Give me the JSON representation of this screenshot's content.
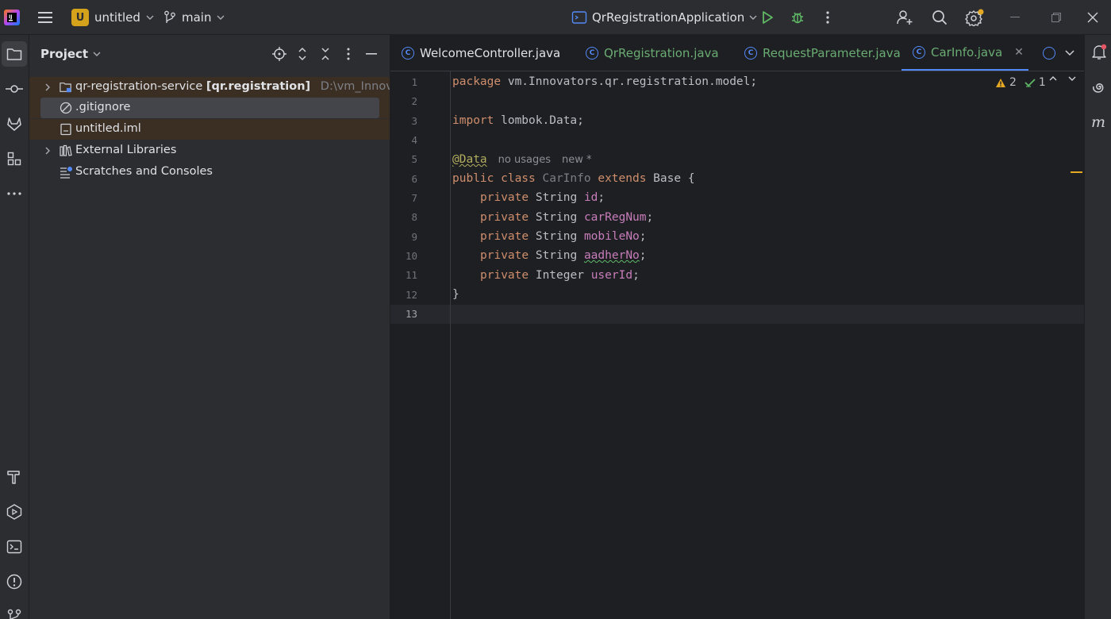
{
  "titlebar": {
    "project_badge": "U",
    "project_name": "untitled",
    "branch_name": "main",
    "run_config": "QrRegistrationApplication"
  },
  "project_panel": {
    "title": "Project",
    "tree": [
      {
        "label": "qr-registration-service",
        "module": "[qr.registration]",
        "path": "D:\\vm_Innovators"
      },
      {
        "label": ".gitignore"
      },
      {
        "label": "untitled.iml"
      },
      {
        "label": "External Libraries"
      },
      {
        "label": "Scratches and Consoles"
      }
    ]
  },
  "tabs": [
    {
      "label": "WelcomeController.java",
      "color": "#dfe1e5"
    },
    {
      "label": "QrRegistration.java",
      "color": "#6aab73"
    },
    {
      "label": "RequestParameter.java",
      "color": "#6aab73"
    },
    {
      "label": "CarInfo.java",
      "color": "#6aab73",
      "active": true
    }
  ],
  "editor": {
    "line_numbers": [
      "1",
      "2",
      "3",
      "4",
      "5",
      "6",
      "7",
      "8",
      "9",
      "10",
      "11",
      "12",
      "13"
    ],
    "warnings_count": "2",
    "ok_count": "1",
    "code": {
      "l1_kw": "package",
      "l1_rest": " vm.Innovators.qr.registration.model;",
      "l3_kw": "import",
      "l3_pkg": " lombok.",
      "l3_cls": "Data",
      "l3_end": ";",
      "l5_ann": "@Data",
      "l5_hint1": "no usages",
      "l5_hint2": "new *",
      "l6_kw1": "public class",
      "l6_cls": " CarInfo ",
      "l6_kw2": "extends",
      "l6_rest": " Base {",
      "fields": [
        {
          "kw": "private",
          "type": " String ",
          "name": "id",
          "end": ";"
        },
        {
          "kw": "private",
          "type": " String ",
          "name": "carRegNum",
          "end": ";"
        },
        {
          "kw": "private",
          "type": " String ",
          "name": "mobileNo",
          "end": ";"
        },
        {
          "kw": "private",
          "type": " String ",
          "name": "aadherNo",
          "end": ";"
        },
        {
          "kw": "private",
          "type": " Integer ",
          "name": "userId",
          "end": ";"
        }
      ],
      "l12": "}"
    }
  },
  "colors": {
    "accent": "#548af7",
    "keyword": "#cf8e6d",
    "field": "#c77dbb",
    "annotation": "#b3ae60",
    "modified_tab": "#6aab73",
    "warning": "#e5a823"
  }
}
